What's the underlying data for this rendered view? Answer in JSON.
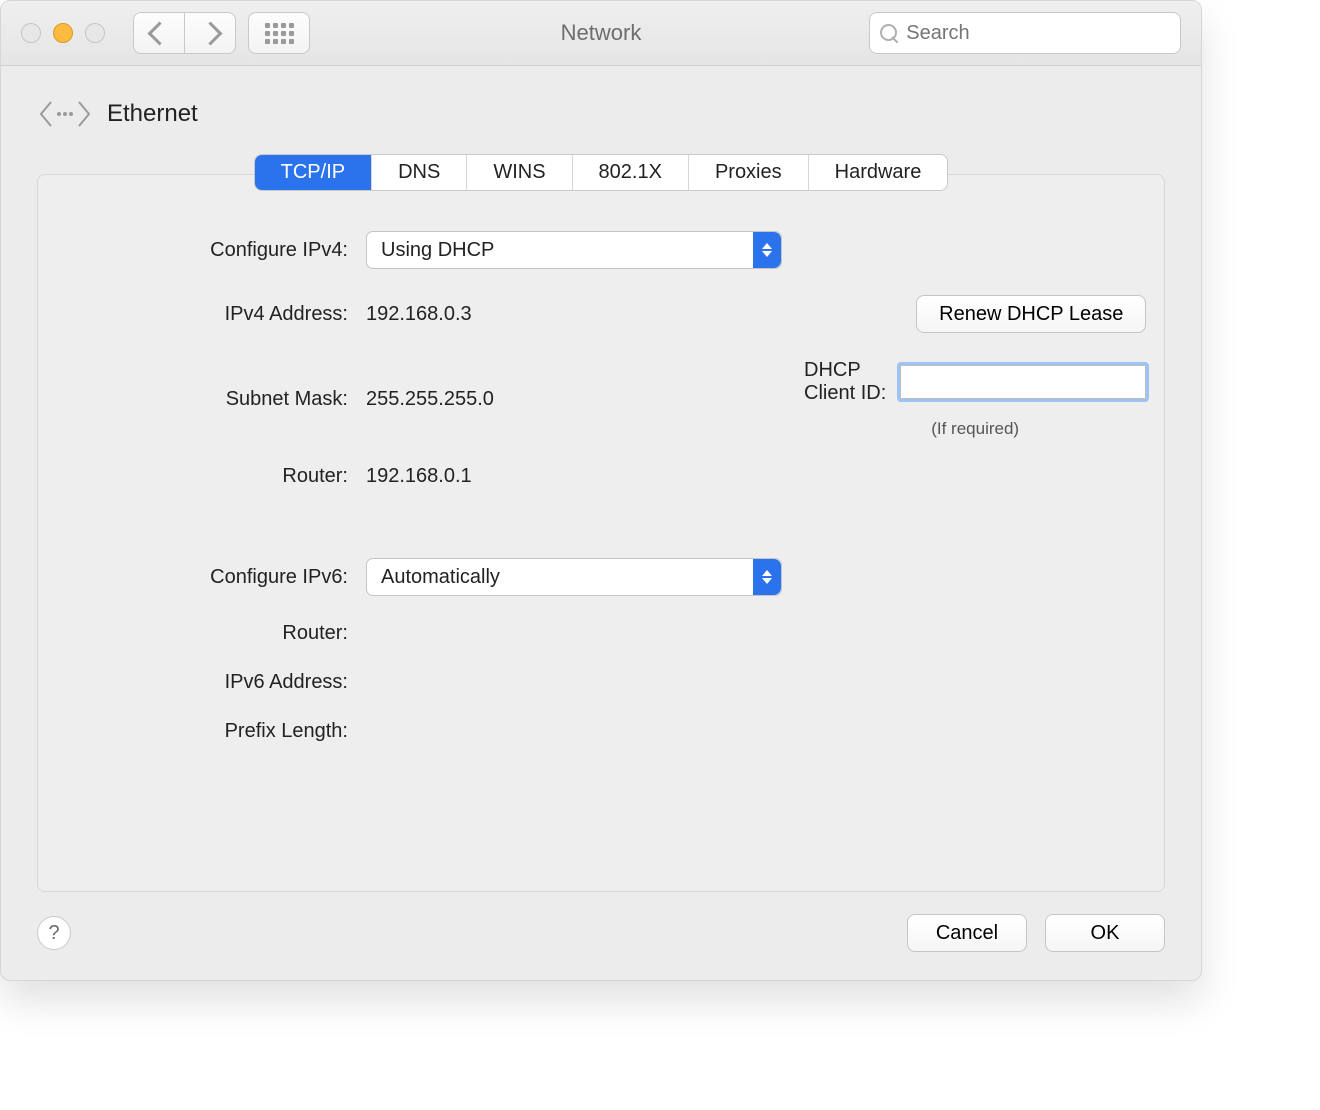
{
  "window": {
    "title": "Network"
  },
  "toolbar": {
    "search_placeholder": "Search"
  },
  "header": {
    "interface_name": "Ethernet"
  },
  "tabs": [
    "TCP/IP",
    "DNS",
    "WINS",
    "802.1X",
    "Proxies",
    "Hardware"
  ],
  "active_tab_index": 0,
  "tcpip": {
    "labels": {
      "configure_ipv4": "Configure IPv4:",
      "ipv4_address": "IPv4 Address:",
      "subnet_mask": "Subnet Mask:",
      "router": "Router:",
      "configure_ipv6": "Configure IPv6:",
      "router6": "Router:",
      "ipv6_address": "IPv6 Address:",
      "prefix_length": "Prefix Length:",
      "dhcp_client_id": "DHCP Client ID:",
      "if_required": "(If required)"
    },
    "values": {
      "configure_ipv4": "Using DHCP",
      "ipv4_address": "192.168.0.3",
      "subnet_mask": "255.255.255.0",
      "router": "192.168.0.1",
      "configure_ipv6": "Automatically",
      "router6": "",
      "ipv6_address": "",
      "prefix_length": "",
      "dhcp_client_id": ""
    },
    "buttons": {
      "renew_dhcp": "Renew DHCP Lease"
    }
  },
  "footer": {
    "cancel": "Cancel",
    "ok": "OK",
    "help": "?"
  }
}
